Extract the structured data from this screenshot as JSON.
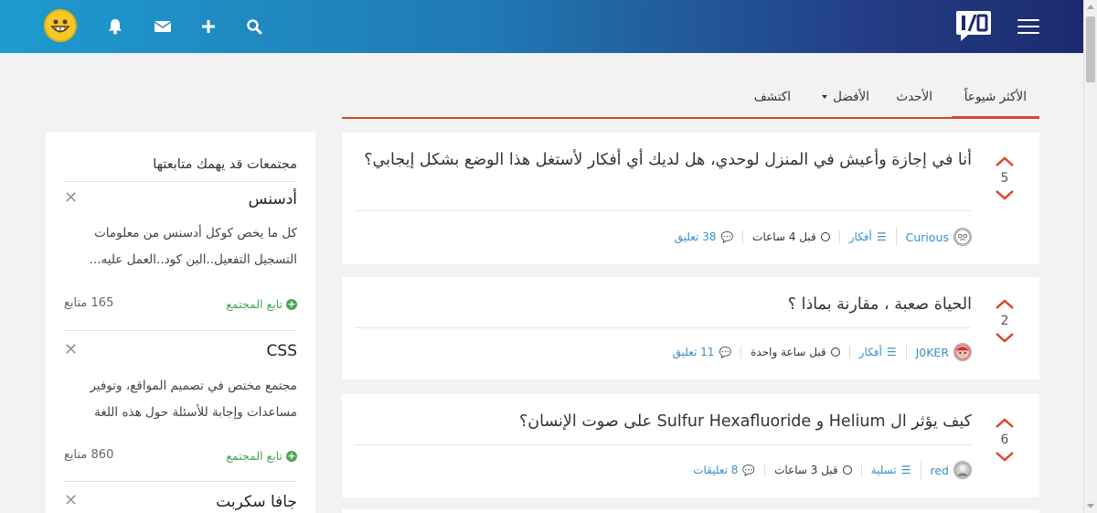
{
  "header": {
    "logo_text": "I/O",
    "icons": [
      "menu-icon",
      "search-icon",
      "plus-icon",
      "mail-icon",
      "bell-icon",
      "avatar"
    ]
  },
  "tabs": [
    {
      "label": "الأكثر شيوعاً",
      "active": true
    },
    {
      "label": "الأحدث",
      "active": false
    },
    {
      "label": "الأفضل",
      "active": false,
      "has_dropdown": true
    },
    {
      "label": "اكتشف",
      "active": false
    }
  ],
  "posts": [
    {
      "votes": "5",
      "title": "أنا في إجازة وأعيش في المنزل لوحدي، هل لديك أي أفكار لأستغل هذا الوضع بشكل إيجابي؟",
      "author": "Curious",
      "category": "أفكار",
      "time": "قبل 4 ساعات",
      "comments": "38 تعليق"
    },
    {
      "votes": "2",
      "title": "الحياة صعبة ، مقارنة بماذا ؟",
      "author": "J0KER",
      "category": "أفكار",
      "time": "قبل ساعة واحدة",
      "comments": "11 تعليق"
    },
    {
      "votes": "6",
      "title": "كيف يؤثر ال Helium و Sulfur Hexafluoride على صوت الإنسان؟",
      "author": "red",
      "category": "تسلية",
      "time": "قبل 3 ساعات",
      "comments": "8 تعليقات"
    }
  ],
  "sidebar": {
    "heading": "مجتمعات قد يهمك متابعتها",
    "communities": [
      {
        "name": "أدسنس",
        "description": "كل ما يخص كوكل أدسنس من معلومات التسجيل التفعيل..البن كود..العمل عليه...",
        "follow_label": "تابع المجتمع",
        "followers": "165 متابع"
      },
      {
        "name": "CSS",
        "description": "مجتمع مختص في تصميم المواقع، وتوفير مساعدات وإجابة للأسئلة حول هذه اللغة",
        "follow_label": "تابع المجتمع",
        "followers": "860 متابع"
      },
      {
        "name": "جافا سكربت",
        "description": "",
        "follow_label": "",
        "followers": ""
      }
    ]
  },
  "colors": {
    "accent": "#d9452b",
    "link": "#3a8fc7",
    "follow": "#4aa553"
  }
}
